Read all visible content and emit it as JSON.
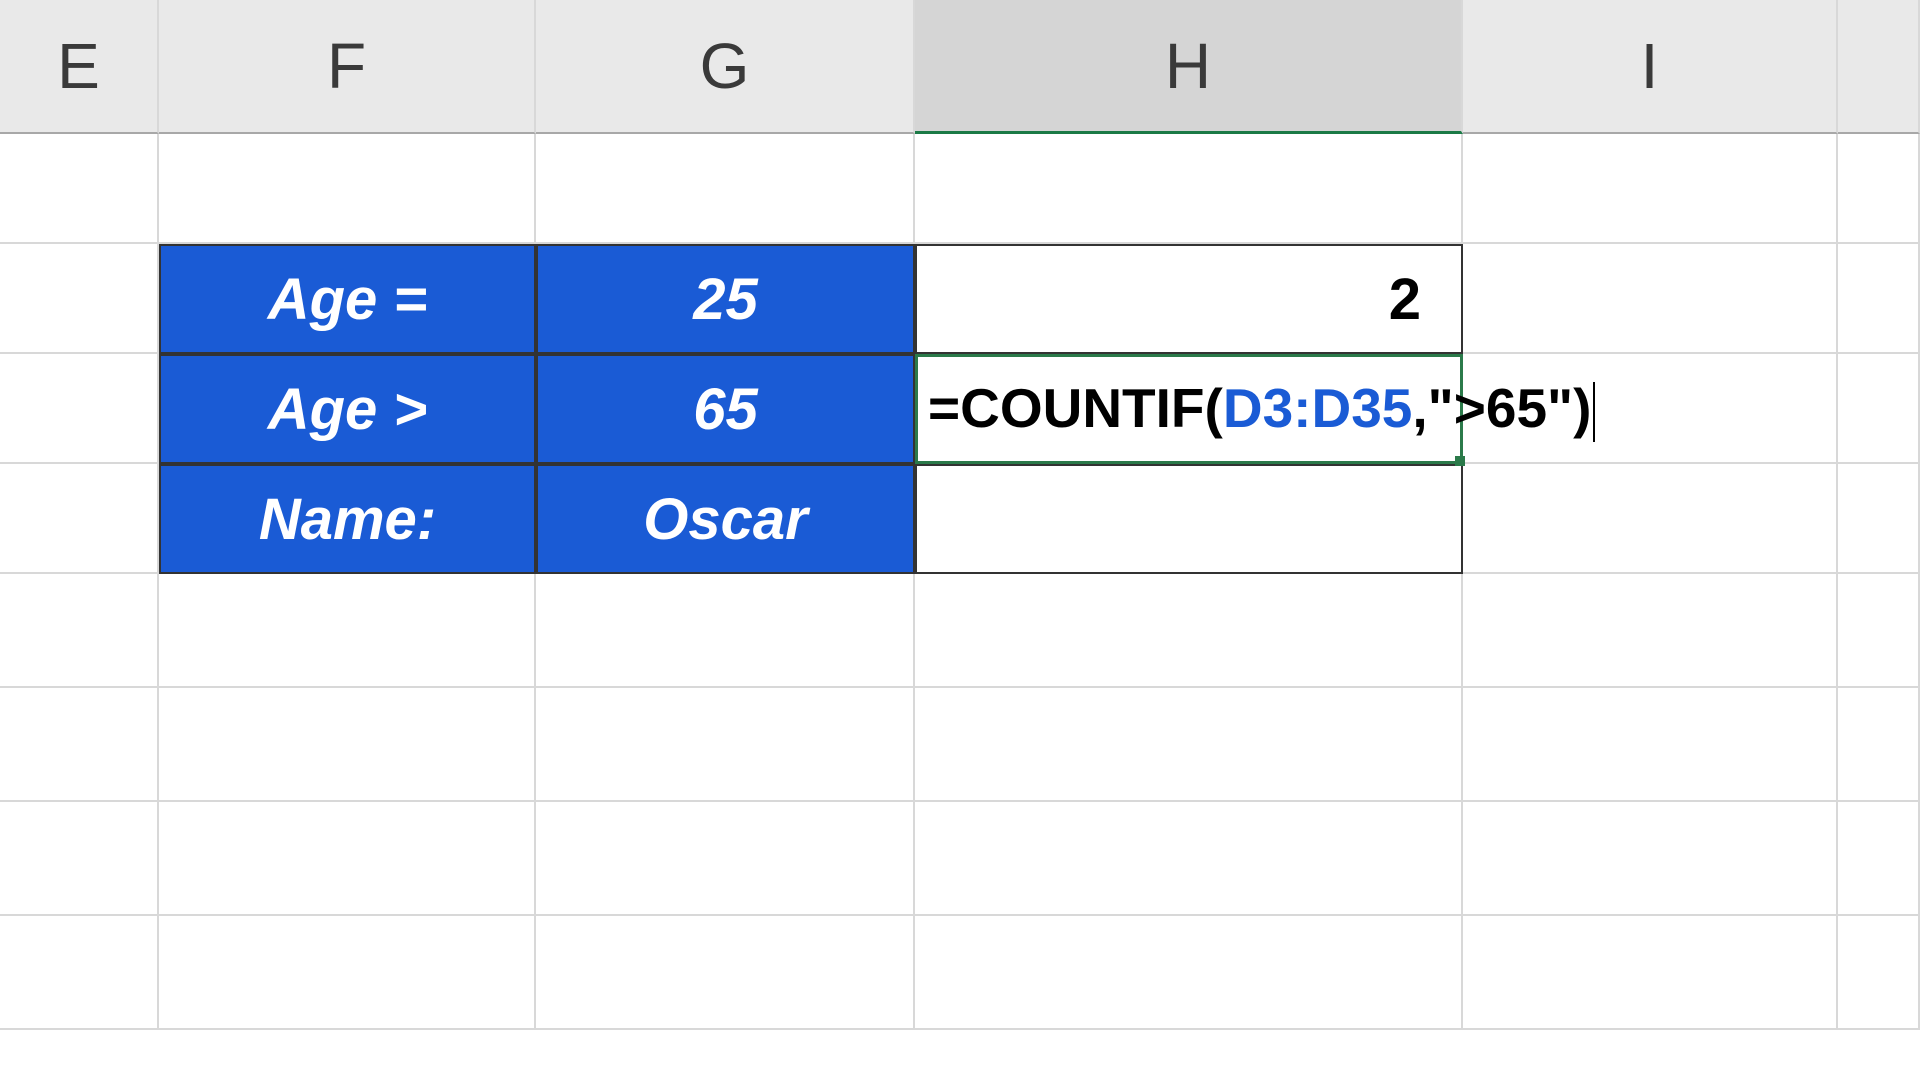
{
  "columns": {
    "E": "E",
    "F": "F",
    "G": "G",
    "H": "H",
    "I": "I"
  },
  "data": {
    "row1": {
      "label": "Age =",
      "value": "25",
      "result": "2"
    },
    "row2": {
      "label": "Age >",
      "value": "65"
    },
    "row3": {
      "label": "Name:",
      "value": "Oscar"
    }
  },
  "formula": {
    "prefix": "=COUNTIF(",
    "range": "D3:D35",
    "suffix": ",\">65\")"
  }
}
